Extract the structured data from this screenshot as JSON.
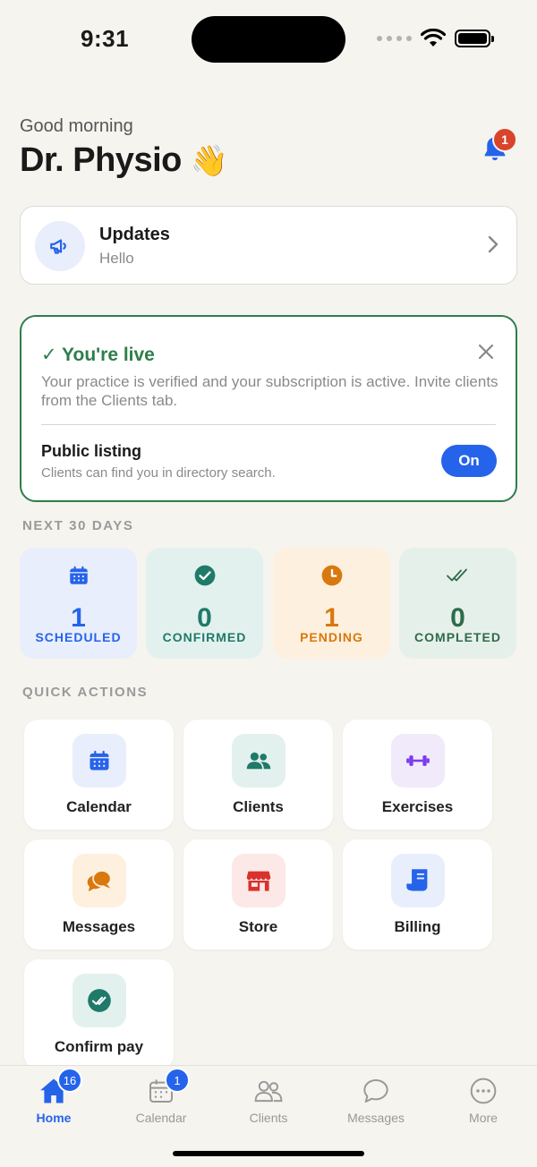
{
  "status_bar": {
    "time": "9:31"
  },
  "header": {
    "greeting": "Good morning",
    "name": "Dr. Physio",
    "wave_emoji": "👋",
    "notifications_count": "1"
  },
  "updates": {
    "title": "Updates",
    "subtitle": "Hello"
  },
  "live_card": {
    "title": "✓ You're live",
    "body": "Your practice is verified and your subscription is active. Invite clients from the Clients tab.",
    "listing_title": "Public listing",
    "listing_subtitle": "Clients can find you in directory search.",
    "toggle_label": "On"
  },
  "stats": {
    "section_label": "NEXT 30 DAYS",
    "items": [
      {
        "value": "1",
        "label": "SCHEDULED",
        "icon": "calendar-icon",
        "color": "#2563eb",
        "bg": "#e8eefb"
      },
      {
        "value": "0",
        "label": "CONFIRMED",
        "icon": "check-circle-icon",
        "color": "#1f7a6a",
        "bg": "#e3f1ee"
      },
      {
        "value": "1",
        "label": "PENDING",
        "icon": "clock-icon",
        "color": "#d9780e",
        "bg": "#fdf0de"
      },
      {
        "value": "0",
        "label": "COMPLETED",
        "icon": "double-check-icon",
        "color": "#2e6b4a",
        "bg": "#e6f0ea"
      }
    ]
  },
  "quick_actions": {
    "section_label": "QUICK ACTIONS",
    "items": [
      {
        "label": "Calendar",
        "icon": "calendar-icon"
      },
      {
        "label": "Clients",
        "icon": "users-icon"
      },
      {
        "label": "Exercises",
        "icon": "dumbbell-icon"
      },
      {
        "label": "Messages",
        "icon": "chat-icon"
      },
      {
        "label": "Store",
        "icon": "store-icon"
      },
      {
        "label": "Billing",
        "icon": "receipt-icon"
      },
      {
        "label": "Confirm pay",
        "icon": "check-badge-icon"
      }
    ]
  },
  "tabbar": {
    "items": [
      {
        "label": "Home",
        "badge": "16",
        "active": true
      },
      {
        "label": "Calendar",
        "badge": "1"
      },
      {
        "label": "Clients"
      },
      {
        "label": "Messages"
      },
      {
        "label": "More"
      }
    ]
  },
  "colors": {
    "accent": "#2563eb",
    "live_green": "#2e7d4a",
    "badge_red": "#d9442b",
    "background": "#f6f4ef"
  }
}
